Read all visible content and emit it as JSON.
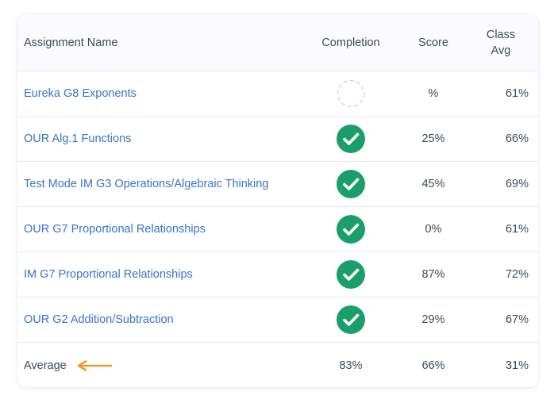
{
  "colors": {
    "link": "#3a72c9",
    "text": "#3e4a5c",
    "check_fill": "#1a9f6a",
    "pending_stroke": "#d9dbe1",
    "arrow": "#f09a2a",
    "header_bg": "#fbfaff"
  },
  "header": {
    "name": "Assignment Name",
    "completion": "Completion",
    "score": "Score",
    "class_avg_line1": "Class",
    "class_avg_line2": "Avg"
  },
  "rows": [
    {
      "name": "Eureka G8 Exponents",
      "completion_icon": "pending-circle-icon",
      "score": "%",
      "class_avg": "61%"
    },
    {
      "name": "OUR Alg.1 Functions",
      "completion_icon": "check-circle-icon",
      "score": "25%",
      "class_avg": "66%"
    },
    {
      "name": "Test Mode IM G3 Operations/Algebraic Thinking",
      "completion_icon": "check-circle-icon",
      "score": "45%",
      "class_avg": "69%"
    },
    {
      "name": "OUR G7 Proportional Relationships",
      "completion_icon": "check-circle-icon",
      "score": "0%",
      "class_avg": "61%"
    },
    {
      "name": "IM G7 Proportional Relationships",
      "completion_icon": "check-circle-icon",
      "score": "87%",
      "class_avg": "72%"
    },
    {
      "name": "OUR G2 Addition/Subtraction",
      "completion_icon": "check-circle-icon",
      "score": "29%",
      "class_avg": "67%"
    }
  ],
  "average": {
    "label": "Average",
    "indicator_icon": "arrow-left-icon",
    "completion": "83%",
    "score": "66%",
    "class_avg": "31%"
  }
}
